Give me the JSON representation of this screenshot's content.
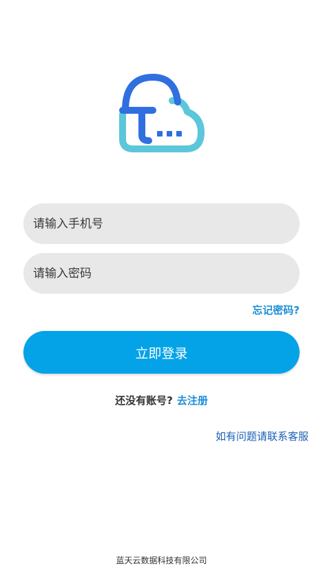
{
  "logo": {
    "icon": "cloud-chat-icon",
    "colors": {
      "blue": "#2f6fe0",
      "teal": "#5cc6db"
    }
  },
  "form": {
    "phone_placeholder": "请输入手机号",
    "password_placeholder": "请输入密码",
    "forgot_password": "忘记密码?",
    "login_button": "立即登录"
  },
  "register": {
    "prompt": "还没有账号?",
    "link": "去注册"
  },
  "support": {
    "label": "如有问题请联系客服"
  },
  "footer": {
    "company": "蓝天云数据科技有限公司"
  },
  "colors": {
    "accent": "#04a3e8",
    "link": "#1e8fd6",
    "support_link": "#1a5fb4",
    "input_bg": "#e8e8e8"
  }
}
